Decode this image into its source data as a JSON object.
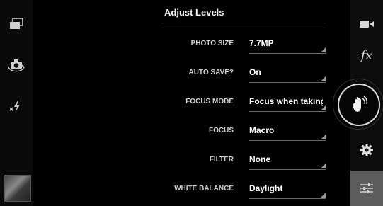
{
  "panel": {
    "title": "Adjust Levels"
  },
  "settings": [
    {
      "label": "PHOTO SIZE",
      "value": "7.7MP"
    },
    {
      "label": "AUTO SAVE?",
      "value": "On"
    },
    {
      "label": "FOCUS MODE",
      "value": "Focus when taking"
    },
    {
      "label": "FOCUS",
      "value": "Macro"
    },
    {
      "label": "FILTER",
      "value": "None"
    },
    {
      "label": "WHITE BALANCE",
      "value": "Daylight"
    }
  ],
  "left_rail": {
    "icons": [
      "aspect-ratio-icon",
      "switch-camera-icon",
      "flash-off-icon"
    ],
    "thumbnail": "gallery-thumbnail"
  },
  "right_rail": {
    "icons": [
      "video-camera-icon",
      "effects-icon",
      "shutter-hand-icon",
      "gear-icon",
      "sliders-icon"
    ],
    "effects_label": "fx"
  },
  "colors": {
    "background": "#000000",
    "rail": "#0c0c0c",
    "active_toggle": "#5d5d5d"
  }
}
